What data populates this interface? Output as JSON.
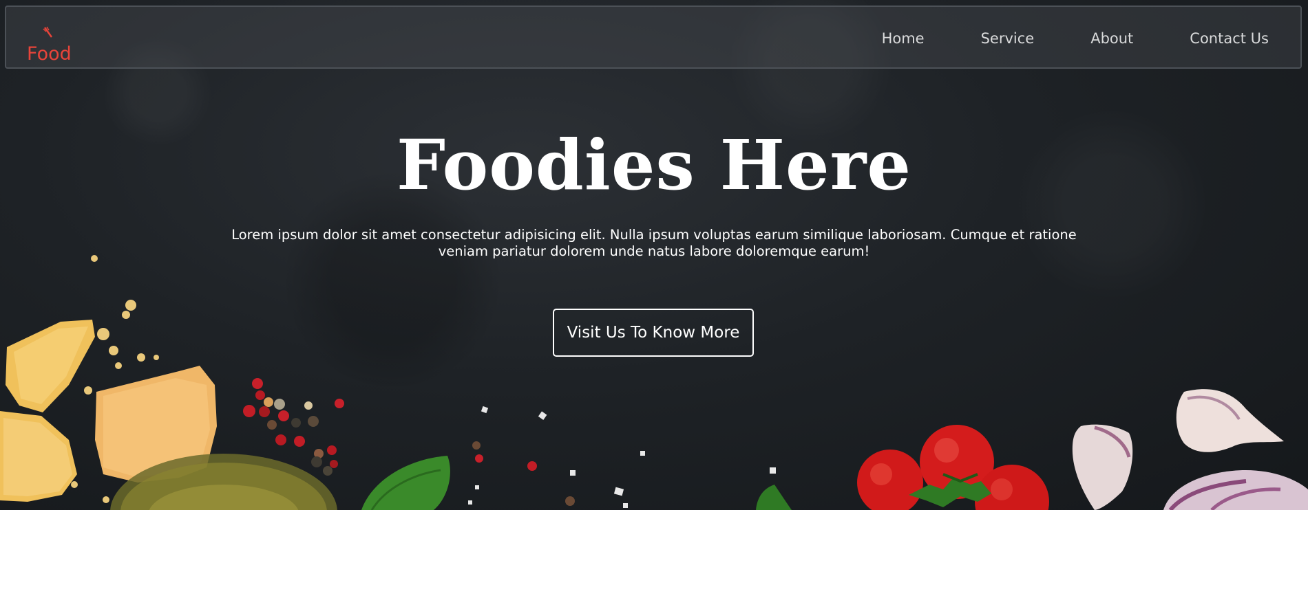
{
  "brand": {
    "logo_text": "Food",
    "logo_color": "#e8443a"
  },
  "nav": {
    "items": [
      {
        "label": "Home"
      },
      {
        "label": "Service"
      },
      {
        "label": "About"
      },
      {
        "label": "Contact Us"
      }
    ]
  },
  "hero": {
    "title": "Foodies Here",
    "description": "Lorem ipsum dolor sit amet consectetur adipisicing elit. Nulla ipsum voluptas earum similique laboriosam. Cumque et ratione veniam pariatur dolorem unde natus labore doloremque earum!",
    "cta_label": "Visit Us To Know More",
    "background_image": "dark slate with cheese, peppercorns, basil, olive oil, cherry tomatoes and garlic"
  },
  "colors": {
    "hero_background": "#1e2226",
    "text": "#ffffff",
    "nav_text": "#d9dadb"
  },
  "icons": {
    "logo_fork": "fork-icon"
  }
}
